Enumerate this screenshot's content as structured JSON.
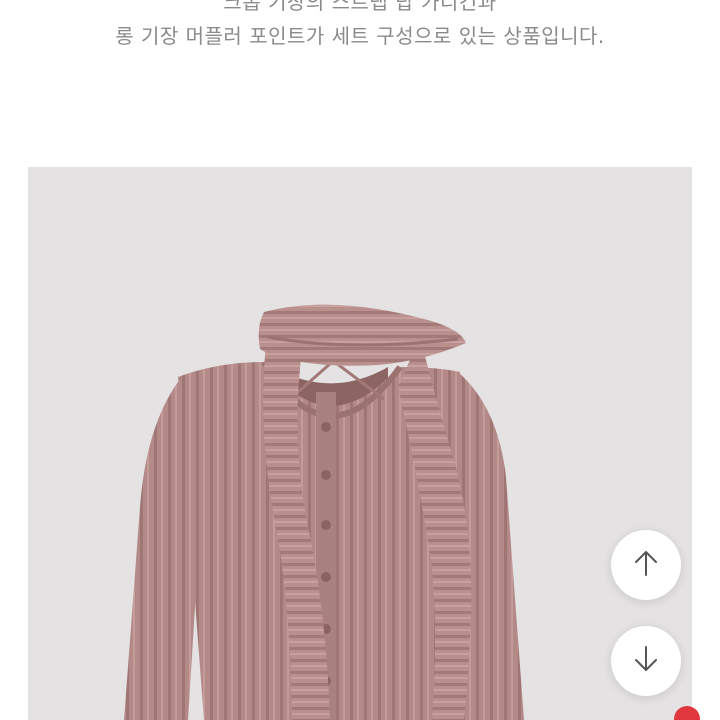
{
  "description": {
    "line1": "크롭 기장의 스트랩 탑 가디건과",
    "line2": "롱 기장 머플러 포인트가 세트 구성으로 있는 상품입니다."
  },
  "product_image": {
    "subject": "mauve pink ribbed knit cardigan with long scarf",
    "background_color": "#e4e2e3",
    "garment_color": "#b08785"
  },
  "scroll_buttons": {
    "up_icon": "arrow-up-icon",
    "down_icon": "arrow-down-icon"
  },
  "badge": {
    "color": "#e0383e"
  }
}
